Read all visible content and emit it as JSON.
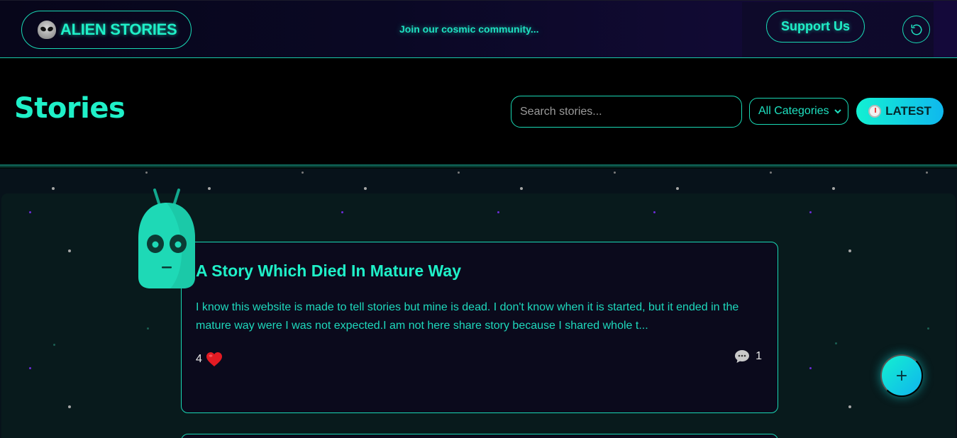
{
  "topbar": {
    "logo_text": "ALIEN STORIES",
    "community_text": "Join our cosmic community...",
    "support_label": "Support Us",
    "refresh_icon": "refresh-icon"
  },
  "header": {
    "title": "Stories",
    "search_placeholder": "Search stories...",
    "category_selected": "All Categories",
    "sort_label": "LATEST",
    "sort_icon": "stopwatch-icon"
  },
  "stories": [
    {
      "title": "A Story Which Died In Mature Way",
      "excerpt": "I know this website is made to tell stories but mine is dead. I don't know when it is started, but it ended in the mature way were I was not expected.I am not here share story because I shared whole t...",
      "likes": "4",
      "comments": "1"
    }
  ],
  "fab": {
    "label": "+"
  },
  "colors": {
    "accent": "#1ff0c8",
    "background": "#000000",
    "card_bg": "#0b0a1c",
    "panel_bg": "#081a1c",
    "gradient_start": "#13f0d2",
    "gradient_end": "#0fb8ee"
  }
}
